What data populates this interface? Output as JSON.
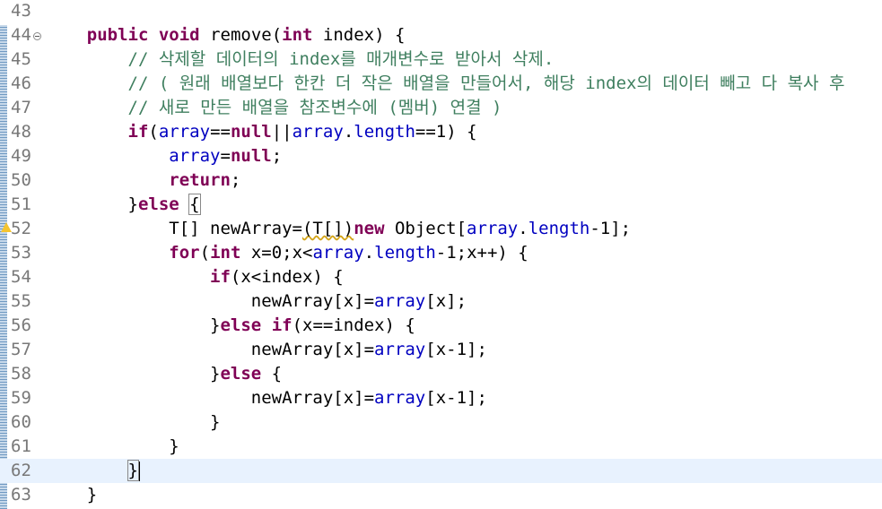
{
  "editor": {
    "language": "java",
    "caret_line": "62",
    "current_line_color": "#e8f2fe",
    "colors": {
      "keyword": "#7f0055",
      "comment": "#3f7f5f",
      "field": "#0000c0",
      "line_number": "#787878"
    },
    "lines": [
      {
        "num": "43",
        "html": ""
      },
      {
        "num": "44",
        "fold": true,
        "html": "    <span class=\"kw\">public</span> <span class=\"kw\">void</span> remove(<span class=\"kw\">int</span> index) {"
      },
      {
        "num": "45",
        "html": "        <span class=\"cm\">// 삭제할 데이터의 index를 매개변수로 받아서 삭제.</span>"
      },
      {
        "num": "46",
        "html": "        <span class=\"cm\">// ( 원래 배열보다 한칸 더 작은 배열을 만들어서, 해당 index의 데이터 빼고 다 복사 후</span>"
      },
      {
        "num": "47",
        "html": "        <span class=\"cm\">// 새로 만든 배열을 참조변수에 (멤버) 연결 )</span>"
      },
      {
        "num": "48",
        "html": "        <span class=\"kw\">if</span>(<span class=\"fd\">array</span>==<span class=\"kw\">null</span>||<span class=\"fd\">array</span>.<span class=\"fd\">length</span>==1) {"
      },
      {
        "num": "49",
        "html": "            <span class=\"fd\">array</span>=<span class=\"kw\">null</span>;"
      },
      {
        "num": "50",
        "html": "            <span class=\"kw\">return</span>;"
      },
      {
        "num": "51",
        "html": "        }<span class=\"kw\">else</span> <span class=\"match\">{</span>"
      },
      {
        "num": "52",
        "warn": true,
        "html": "            T[] newArray=<span class=\"squig\">(T[])</span><span class=\"kw\">new</span> Object[<span class=\"fd\">array</span>.<span class=\"fd\">length</span>-1];"
      },
      {
        "num": "53",
        "html": "            <span class=\"kw\">for</span>(<span class=\"kw\">int</span> x=0;x&lt;<span class=\"fd\">array</span>.<span class=\"fd\">length</span>-1;x++) {"
      },
      {
        "num": "54",
        "html": "                <span class=\"kw\">if</span>(x&lt;index) {"
      },
      {
        "num": "55",
        "html": "                    newArray[x]=<span class=\"fd\">array</span>[x];"
      },
      {
        "num": "56",
        "html": "                }<span class=\"kw\">else</span> <span class=\"kw\">if</span>(x==index) {"
      },
      {
        "num": "57",
        "html": "                    newArray[x]=<span class=\"fd\">array</span>[x-1];"
      },
      {
        "num": "58",
        "html": "                }<span class=\"kw\">else</span> {"
      },
      {
        "num": "59",
        "html": "                    newArray[x]=<span class=\"fd\">array</span>[x-1];"
      },
      {
        "num": "60",
        "html": "                }"
      },
      {
        "num": "61",
        "html": "            }"
      },
      {
        "num": "62",
        "current": true,
        "html": "        <span class=\"match\">}</span>"
      },
      {
        "num": "63",
        "html": "    }"
      }
    ]
  }
}
